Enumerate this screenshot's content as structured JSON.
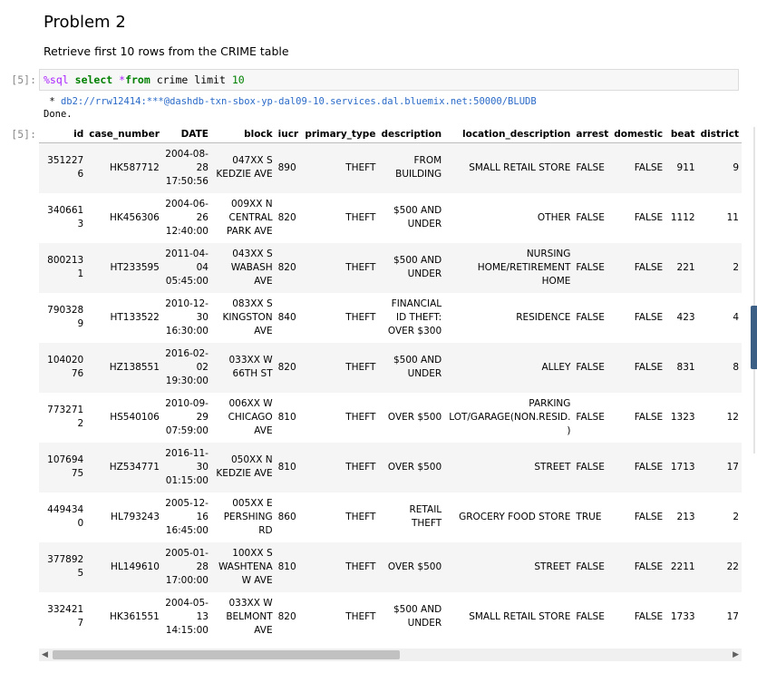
{
  "heading": "Problem 2",
  "subtext": "Retrieve first 10 rows from the CRIME table",
  "input": {
    "prompt": "[5]:",
    "magic": "%sql",
    "kw_select": "select",
    "op_star": "*",
    "kw_from": "from",
    "table": "crime",
    "kw_limit": "limit",
    "limit_val": "10"
  },
  "output": {
    "conn_prefix": " * ",
    "conn_url": "db2://rrw12414:***@dashdb-txn-sbox-yp-dal09-10.services.dal.bluemix.net:50000/BLUDB",
    "done": "Done.",
    "prompt": "[5]:"
  },
  "table": {
    "columns": [
      "id",
      "case_number",
      "DATE",
      "block",
      "iucr",
      "primary_type",
      "description",
      "location_description",
      "arrest",
      "domestic",
      "beat",
      "district"
    ],
    "rows": [
      [
        "3512276",
        "HK587712",
        "2004-08-28 17:50:56",
        "047XX S KEDZIE AVE",
        "890",
        "THEFT",
        "FROM BUILDING",
        "SMALL RETAIL STORE",
        "FALSE",
        "FALSE",
        "911",
        "9"
      ],
      [
        "3406613",
        "HK456306",
        "2004-06-26 12:40:00",
        "009XX N CENTRAL PARK AVE",
        "820",
        "THEFT",
        "$500 AND UNDER",
        "OTHER",
        "FALSE",
        "FALSE",
        "1112",
        "11"
      ],
      [
        "8002131",
        "HT233595",
        "2011-04-04 05:45:00",
        "043XX S WABASH AVE",
        "820",
        "THEFT",
        "$500 AND UNDER",
        "NURSING HOME/RETIREMENT HOME",
        "FALSE",
        "FALSE",
        "221",
        "2"
      ],
      [
        "7903289",
        "HT133522",
        "2010-12-30 16:30:00",
        "083XX S KINGSTON AVE",
        "840",
        "THEFT",
        "FINANCIAL ID THEFT: OVER $300",
        "RESIDENCE",
        "FALSE",
        "FALSE",
        "423",
        "4"
      ],
      [
        "10402076",
        "HZ138551",
        "2016-02-02 19:30:00",
        "033XX W 66TH ST",
        "820",
        "THEFT",
        "$500 AND UNDER",
        "ALLEY",
        "FALSE",
        "FALSE",
        "831",
        "8"
      ],
      [
        "7732712",
        "HS540106",
        "2010-09-29 07:59:00",
        "006XX W CHICAGO AVE",
        "810",
        "THEFT",
        "OVER $500",
        "PARKING LOT/GARAGE(NON.RESID.)",
        "FALSE",
        "FALSE",
        "1323",
        "12"
      ],
      [
        "10769475",
        "HZ534771",
        "2016-11-30 01:15:00",
        "050XX N KEDZIE AVE",
        "810",
        "THEFT",
        "OVER $500",
        "STREET",
        "FALSE",
        "FALSE",
        "1713",
        "17"
      ],
      [
        "4494340",
        "HL793243",
        "2005-12-16 16:45:00",
        "005XX E PERSHING RD",
        "860",
        "THEFT",
        "RETAIL THEFT",
        "GROCERY FOOD STORE",
        "TRUE",
        "FALSE",
        "213",
        "2"
      ],
      [
        "3778925",
        "HL149610",
        "2005-01-28 17:00:00",
        "100XX S WASHTENAW AVE",
        "810",
        "THEFT",
        "OVER $500",
        "STREET",
        "FALSE",
        "FALSE",
        "2211",
        "22"
      ],
      [
        "3324217",
        "HK361551",
        "2004-05-13 14:15:00",
        "033XX W BELMONT AVE",
        "820",
        "THEFT",
        "$500 AND UNDER",
        "SMALL RETAIL STORE",
        "FALSE",
        "FALSE",
        "1733",
        "17"
      ]
    ]
  },
  "icons": {
    "scroll_left": "◀",
    "scroll_right": "▶"
  }
}
